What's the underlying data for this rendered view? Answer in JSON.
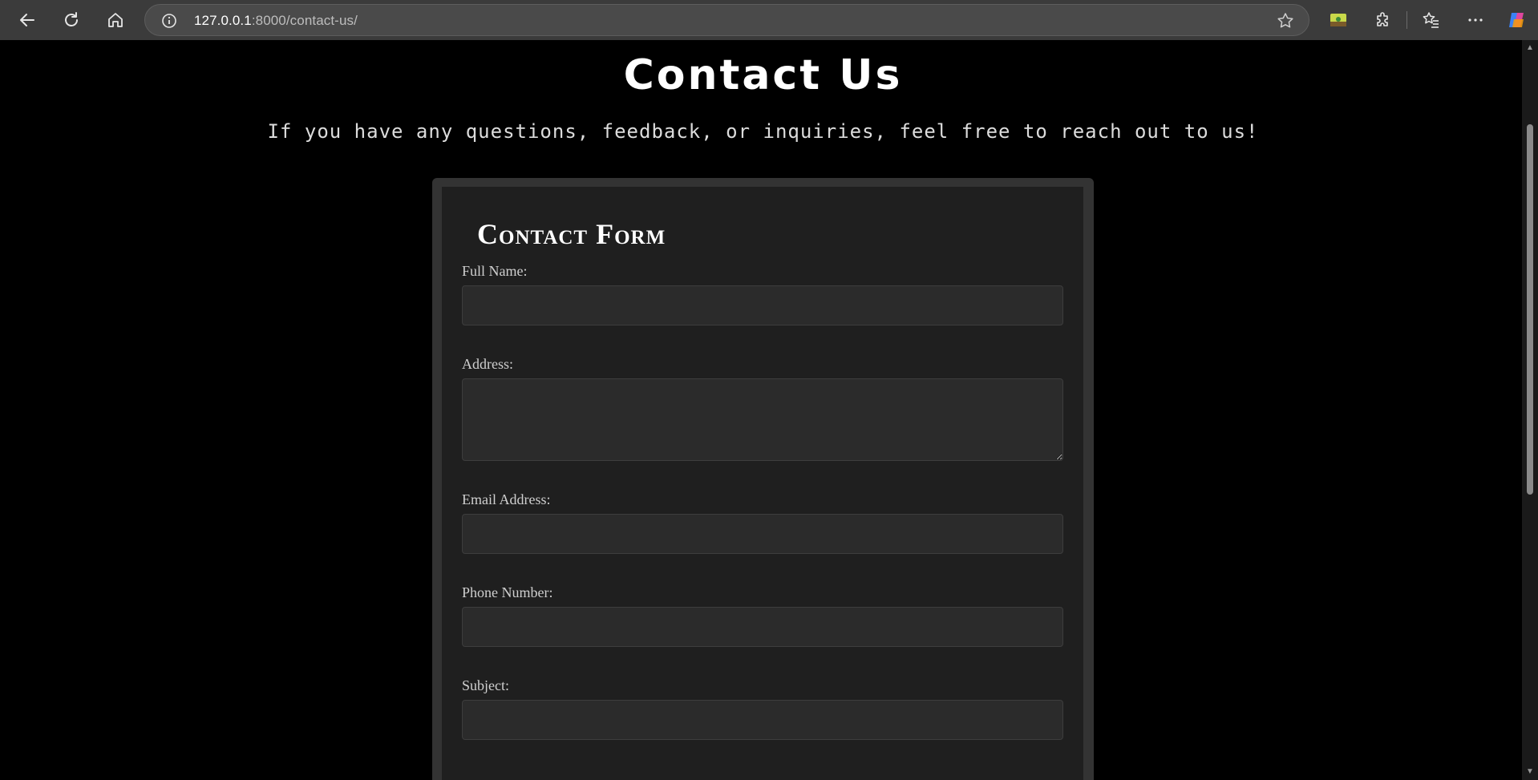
{
  "browser": {
    "url_host": "127.0.0.1",
    "url_path": ":8000/contact-us/",
    "icons": [
      "back-icon",
      "reload-icon",
      "home-icon",
      "info-icon",
      "star-icon",
      "extension-app-icon",
      "puzzle-icon",
      "favorites-icon",
      "more-icon",
      "copilot-icon"
    ]
  },
  "page": {
    "title": "Contact Us",
    "subtitle": "If you have any questions, feedback, or inquiries, feel free to reach out to us!"
  },
  "form": {
    "title": "Contact Form",
    "fields": [
      {
        "label": "Full Name:",
        "value": ""
      },
      {
        "label": "Address:",
        "value": ""
      },
      {
        "label": "Email Address:",
        "value": ""
      },
      {
        "label": "Phone Number:",
        "value": ""
      },
      {
        "label": "Subject:",
        "value": ""
      }
    ]
  },
  "colors": {
    "page_bg": "#000000",
    "form_border": "#333333",
    "form_bg": "#1f1f1f",
    "input_bg": "#2b2b2b"
  }
}
